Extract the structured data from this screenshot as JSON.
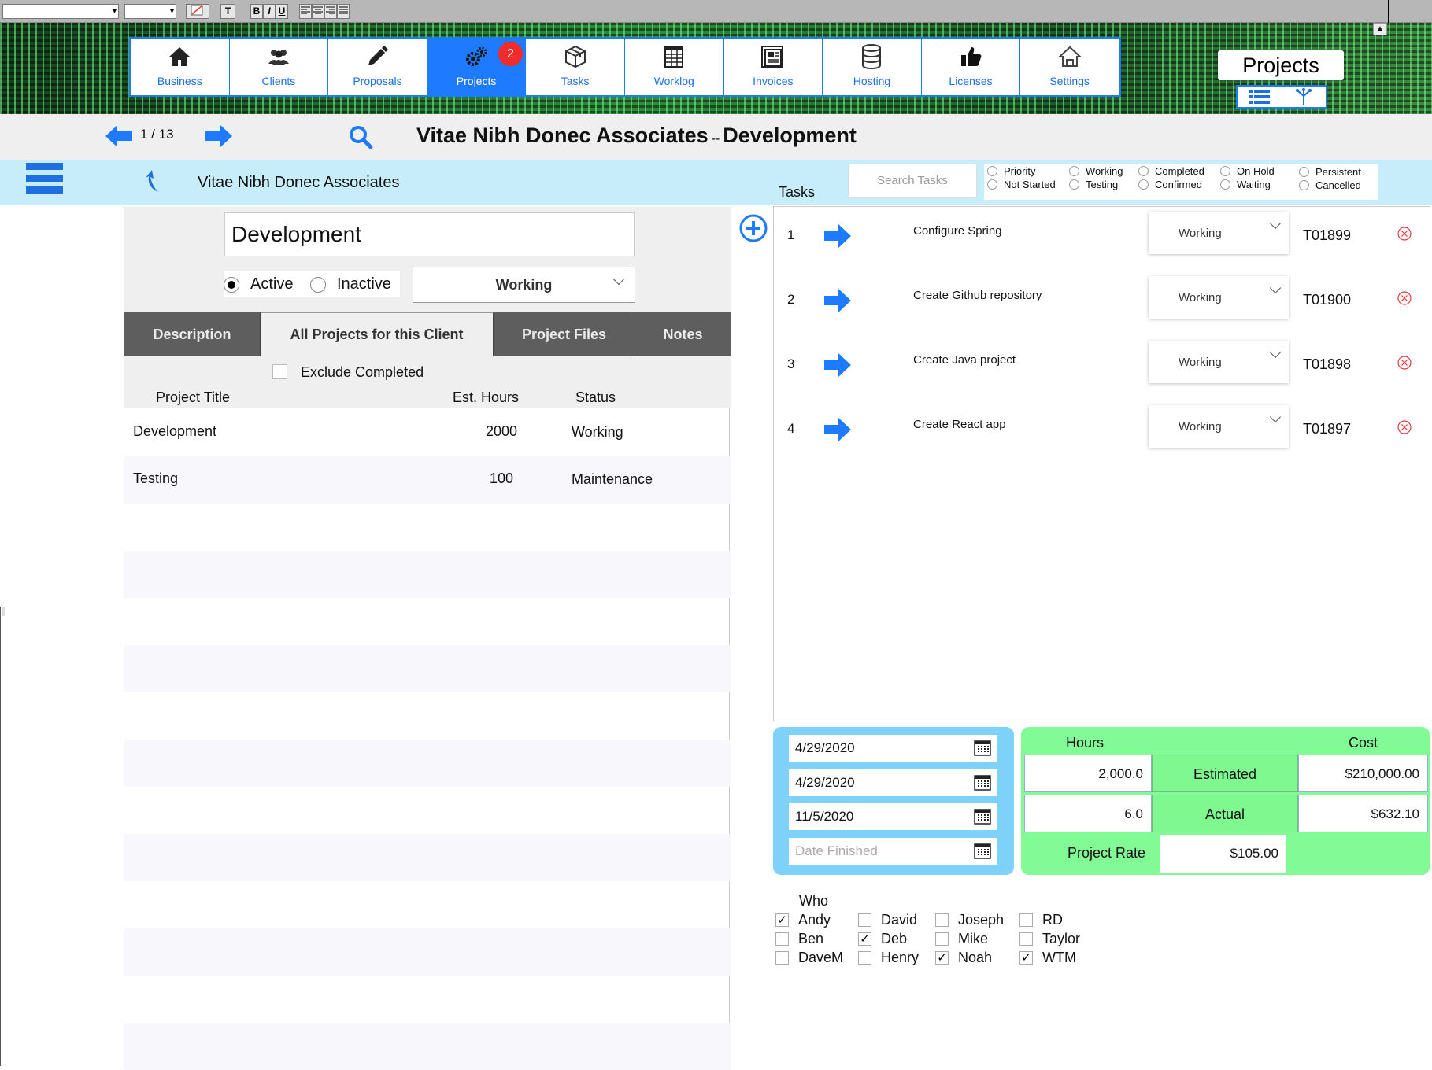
{
  "toolbar": {
    "font_family": "",
    "font_size": "",
    "bold": "B",
    "italic": "I",
    "underline": "U",
    "text_color_icon": "text-color-icon",
    "style_label": "T"
  },
  "nav": {
    "items": [
      {
        "label": "Business",
        "icon": "home-icon"
      },
      {
        "label": "Clients",
        "icon": "people-icon"
      },
      {
        "label": "Proposals",
        "icon": "pencil-icon"
      },
      {
        "label": "Projects",
        "icon": "gears-icon",
        "active": true,
        "badge": "2"
      },
      {
        "label": "Tasks",
        "icon": "box-icon"
      },
      {
        "label": "Worklog",
        "icon": "worklog-table-icon"
      },
      {
        "label": "Invoices",
        "icon": "invoice-icon"
      },
      {
        "label": "Hosting",
        "icon": "database-icon"
      },
      {
        "label": "Licenses",
        "icon": "thumbs-up-icon"
      },
      {
        "label": "Settings",
        "icon": "settings-house-icon"
      }
    ]
  },
  "module_title": "Projects",
  "record": {
    "counter": "1 / 13",
    "title_client": "Vitae Nibh Donec Associates",
    "title_sep": "--",
    "title_project": "Development"
  },
  "client_bar": {
    "client_name": "Vitae Nibh Donec Associates"
  },
  "tasks": {
    "heading": "Tasks",
    "search_placeholder": "Search Tasks",
    "filters": {
      "priority": "Priority",
      "not_started": "Not Started",
      "working": "Working",
      "testing": "Testing",
      "completed": "Completed",
      "confirmed": "Confirmed",
      "on_hold": "On Hold",
      "waiting": "Waiting",
      "persistent": "Persistent",
      "cancelled": "Cancelled"
    },
    "rows": [
      {
        "num": "1",
        "name": "Configure Spring",
        "status": "Working",
        "id": "T01899"
      },
      {
        "num": "2",
        "name": "Create Github repository",
        "status": "Working",
        "id": "T01900"
      },
      {
        "num": "3",
        "name": "Create Java project",
        "status": "Working",
        "id": "T01898"
      },
      {
        "num": "4",
        "name": "Create React app",
        "status": "Working",
        "id": "T01897"
      }
    ]
  },
  "project": {
    "name": "Development",
    "active_label": "Active",
    "inactive_label": "Inactive",
    "status": "Working"
  },
  "tabs": {
    "description": "Description",
    "all_projects": "All Projects for this Client",
    "files": "Project Files",
    "notes": "Notes"
  },
  "project_list": {
    "exclude_label": "Exclude Completed",
    "col_title": "Project Title",
    "col_hours": "Est. Hours",
    "col_status": "Status",
    "rows": [
      {
        "title": "Development",
        "hours": "2000",
        "status": "Working"
      },
      {
        "title": "Testing",
        "hours": "100",
        "status": "Maintenance"
      }
    ]
  },
  "dates": {
    "d1": "4/29/2020",
    "d2": "4/29/2020",
    "d3": "11/5/2020",
    "finished_placeholder": "Date Finished"
  },
  "costs": {
    "hours_label": "Hours",
    "cost_label": "Cost",
    "est_hours": "2,000.0",
    "estimated_label": "Estimated",
    "est_cost": "$210,000.00",
    "act_hours": "6.0",
    "actual_label": "Actual",
    "act_cost": "$632.10",
    "rate_label": "Project Rate",
    "rate": "$105.00"
  },
  "who": {
    "label": "Who",
    "people": [
      {
        "name": "Andy",
        "checked": true
      },
      {
        "name": "Ben",
        "checked": false
      },
      {
        "name": "DaveM",
        "checked": false
      },
      {
        "name": "David",
        "checked": false
      },
      {
        "name": "Deb",
        "checked": true
      },
      {
        "name": "Henry",
        "checked": false
      },
      {
        "name": "Joseph",
        "checked": false
      },
      {
        "name": "Mike",
        "checked": false
      },
      {
        "name": "Noah",
        "checked": true
      },
      {
        "name": "RD",
        "checked": false
      },
      {
        "name": "Taylor",
        "checked": false
      },
      {
        "name": "WTM",
        "checked": true
      }
    ]
  },
  "colors": {
    "accent": "#1e7bff",
    "badge": "#f22b2b",
    "client_bar": "#c7ecfa",
    "dates_panel": "#7ed2fa",
    "cost_panel": "#82fa96",
    "tabs_bg": "#5e5e5e",
    "delete_icon": "#e23a3a"
  }
}
